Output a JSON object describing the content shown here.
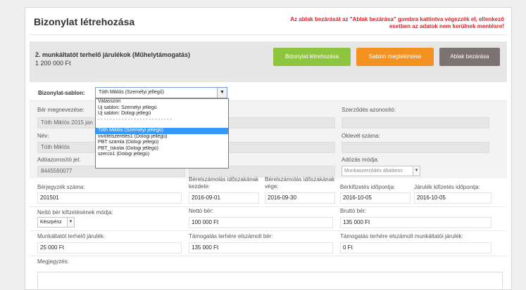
{
  "dialog": {
    "title": "Bizonylat létrehozása",
    "warning": "Az ablak bezárását az \"Ablak bezárása\" gombra kattintva végezzék el, ellenkező esetben az adatok nem kerülnek mentésre!"
  },
  "band": {
    "title": "2. munkáltatót terhelő járulékok (Műhelytámogatás)",
    "amount": "1 200 000 Ft",
    "buttons": {
      "create": "Bizonylat létrehozása",
      "preview": "Sablon megtekintése",
      "close": "Ablak bezárása"
    }
  },
  "template": {
    "label": "Bizonylat-sablon:",
    "selected": "Tóth Miklós (Személyi jellegű)",
    "options": [
      "Válasszon",
      "Új sablon: Személyi jellegű",
      "Új sablon: Dologi jellegű",
      "- - - - - - - - - - - - - - - - - - - - - - - - -",
      "Tóth Miklós (Személyi jellegű)",
      "vivőfelszerelés1 (Dologi jellegű)",
      "PBT számla (Dologi jellegű)",
      "PBT_Iskolai (Dologi jellegű)",
      "szerco1 (Dologi jellegű)"
    ]
  },
  "form": {
    "ber_megnevezese": {
      "label": "Bér megnevezése:",
      "value": "Tóth Miklós 2015 jan"
    },
    "szerzodes": {
      "label": "Szerződés azonosító:",
      "value": ""
    },
    "nev": {
      "label": "Név:",
      "value": "Tóth Miklós"
    },
    "oklevel": {
      "label": "Oklevél száma:",
      "value": ""
    },
    "adoazonosito": {
      "label": "Adóazonosító jel:",
      "value": "8445560077"
    },
    "adozas": {
      "label": "Adózás módja:",
      "value": "Munkaszerződés általános"
    },
    "berjegyzek": {
      "label": "Bérjegyzék száma:",
      "value": "201501"
    },
    "kezdete": {
      "label": "Bérelszámolás időszakának kezdete:",
      "value": "2016-09-01"
    },
    "vege": {
      "label": "Bérelszámolás időszakának vége:",
      "value": "2016-09-30"
    },
    "berkifizetes": {
      "label": "Bérkifizetés időpontja:",
      "value": "2016-10-05"
    },
    "jarulek_kifizetes": {
      "label": "Járulék kifizetés időpontja:",
      "value": "2016-10-05"
    },
    "netto_mod": {
      "label": "Nettó bér kifizetésének módja:",
      "value": "Készpénz"
    },
    "netto": {
      "label": "Nettó bér:",
      "value": "100 000 Ft"
    },
    "brutto": {
      "label": "Bruttó bér:",
      "value": "135 000 Ft"
    },
    "munkaltatoi_jarulek": {
      "label": "Munkáltatót terhelő járulék:",
      "value": "25 000 Ft"
    },
    "tamogatas_ber": {
      "label": "Támogatás terhére elszámolt bér:",
      "value": "135 000 Ft"
    },
    "tamogatas_jarulek": {
      "label": "Támogatás terhére elszámolt munkáltatói járulék:",
      "value": "0 Ft"
    },
    "megjegyzes": {
      "label": "Megjegyzés:"
    }
  }
}
